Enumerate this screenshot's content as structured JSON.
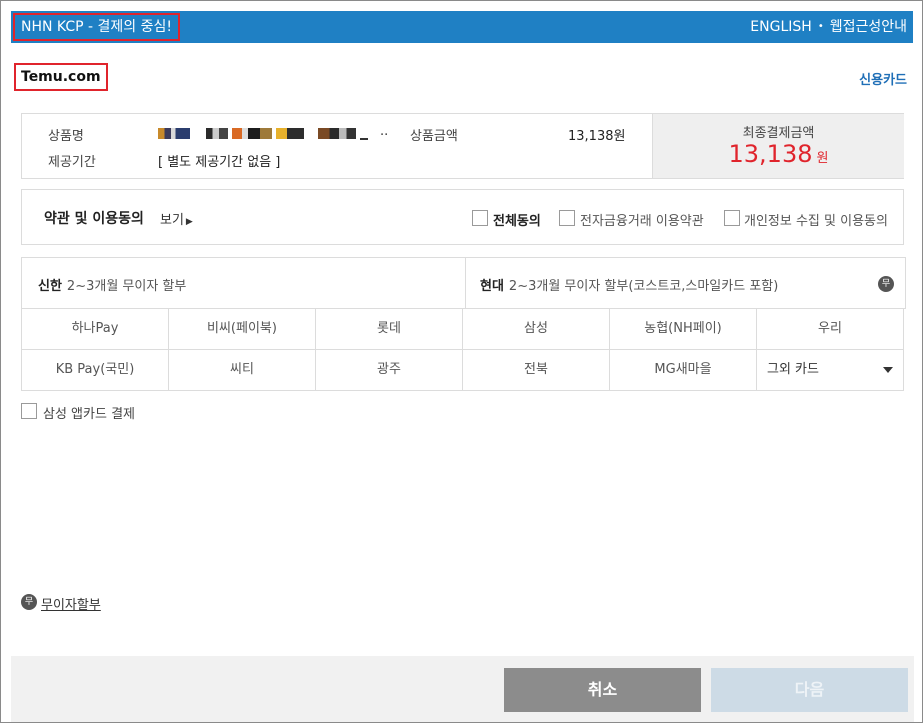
{
  "header": {
    "brand": "NHN KCP - 결제의 중심!",
    "english": "ENGLISH",
    "accessibility": "웹접근성안내",
    "bar_color": "#1f80c4"
  },
  "merchant": "Temu.com",
  "payment_method": "신용카드",
  "summary": {
    "product_name_label": "상품명",
    "product_name_trail": "..",
    "period_label": "제공기간",
    "period_value": "[ 별도 제공기간 없음 ]",
    "price_label": "상품금액",
    "price_value": "13,138원",
    "final_label": "최종결제금액",
    "final_amount": "13,138",
    "final_unit": "원",
    "accent_color": "#e0242c"
  },
  "terms": {
    "title": "약관 및 이용동의",
    "view": "보기",
    "agree_all": "전체동의",
    "efinance": "전자금융거래 이용약관",
    "privacy": "개인정보 수집 및 이용동의"
  },
  "promos": {
    "shinhan_name": "신한",
    "shinhan_text": "2~3개월 무이자 할부",
    "hyundai_name": "현대",
    "hyundai_text": "2~3개월 무이자 할부(코스트코,스마일카드 포함)",
    "badge": "무"
  },
  "cards": {
    "row1": [
      "하나Pay",
      "비씨(페이북)",
      "롯데",
      "삼성",
      "농협(NH페이)",
      "우리"
    ],
    "row2": [
      "KB Pay(국민)",
      "씨티",
      "광주",
      "전북",
      "MG새마을"
    ],
    "other_select": "그외 카드"
  },
  "samsung_app": "삼성 앱카드 결제",
  "no_interest": {
    "badge": "무",
    "link": "무이자할부"
  },
  "footer": {
    "cancel": "취소",
    "next": "다음"
  }
}
